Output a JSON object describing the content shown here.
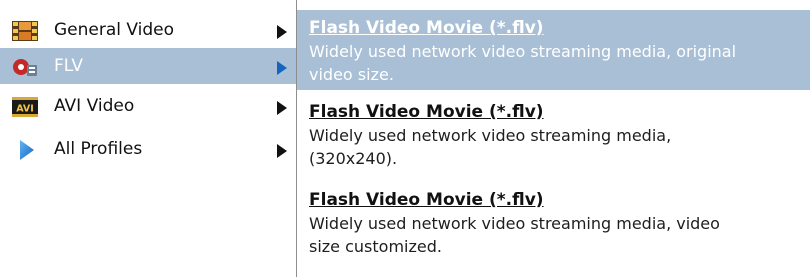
{
  "menu": {
    "items": [
      {
        "label": "General Video",
        "icon": "film-strip-icon",
        "selected": false
      },
      {
        "label": "FLV",
        "icon": "flash-video-icon",
        "selected": true
      },
      {
        "label": "AVI Video",
        "icon": "avi-icon",
        "icon_text": "AVI",
        "selected": false
      },
      {
        "label": "All Profiles",
        "icon": "play-triangle-icon",
        "selected": false
      }
    ],
    "arrow_icon": "submenu-arrow-icon"
  },
  "profiles": [
    {
      "title": "Flash Video Movie (*.flv)",
      "desc_line1": "Widely used network video streaming media, original",
      "desc_line2": "video size.",
      "selected": true
    },
    {
      "title": "Flash Video Movie (*.flv)",
      "desc_line1": "Widely used network video streaming media,",
      "desc_line2": "(320x240).",
      "selected": false
    },
    {
      "title": "Flash Video Movie (*.flv)",
      "desc_line1": "Widely used network video streaming media, video",
      "desc_line2": "size customized.",
      "selected": false
    }
  ],
  "colors": {
    "selection": "#a8bfd6",
    "separator": "#8e8e8e",
    "text": "#111111",
    "selected_text": "#ffffff"
  }
}
